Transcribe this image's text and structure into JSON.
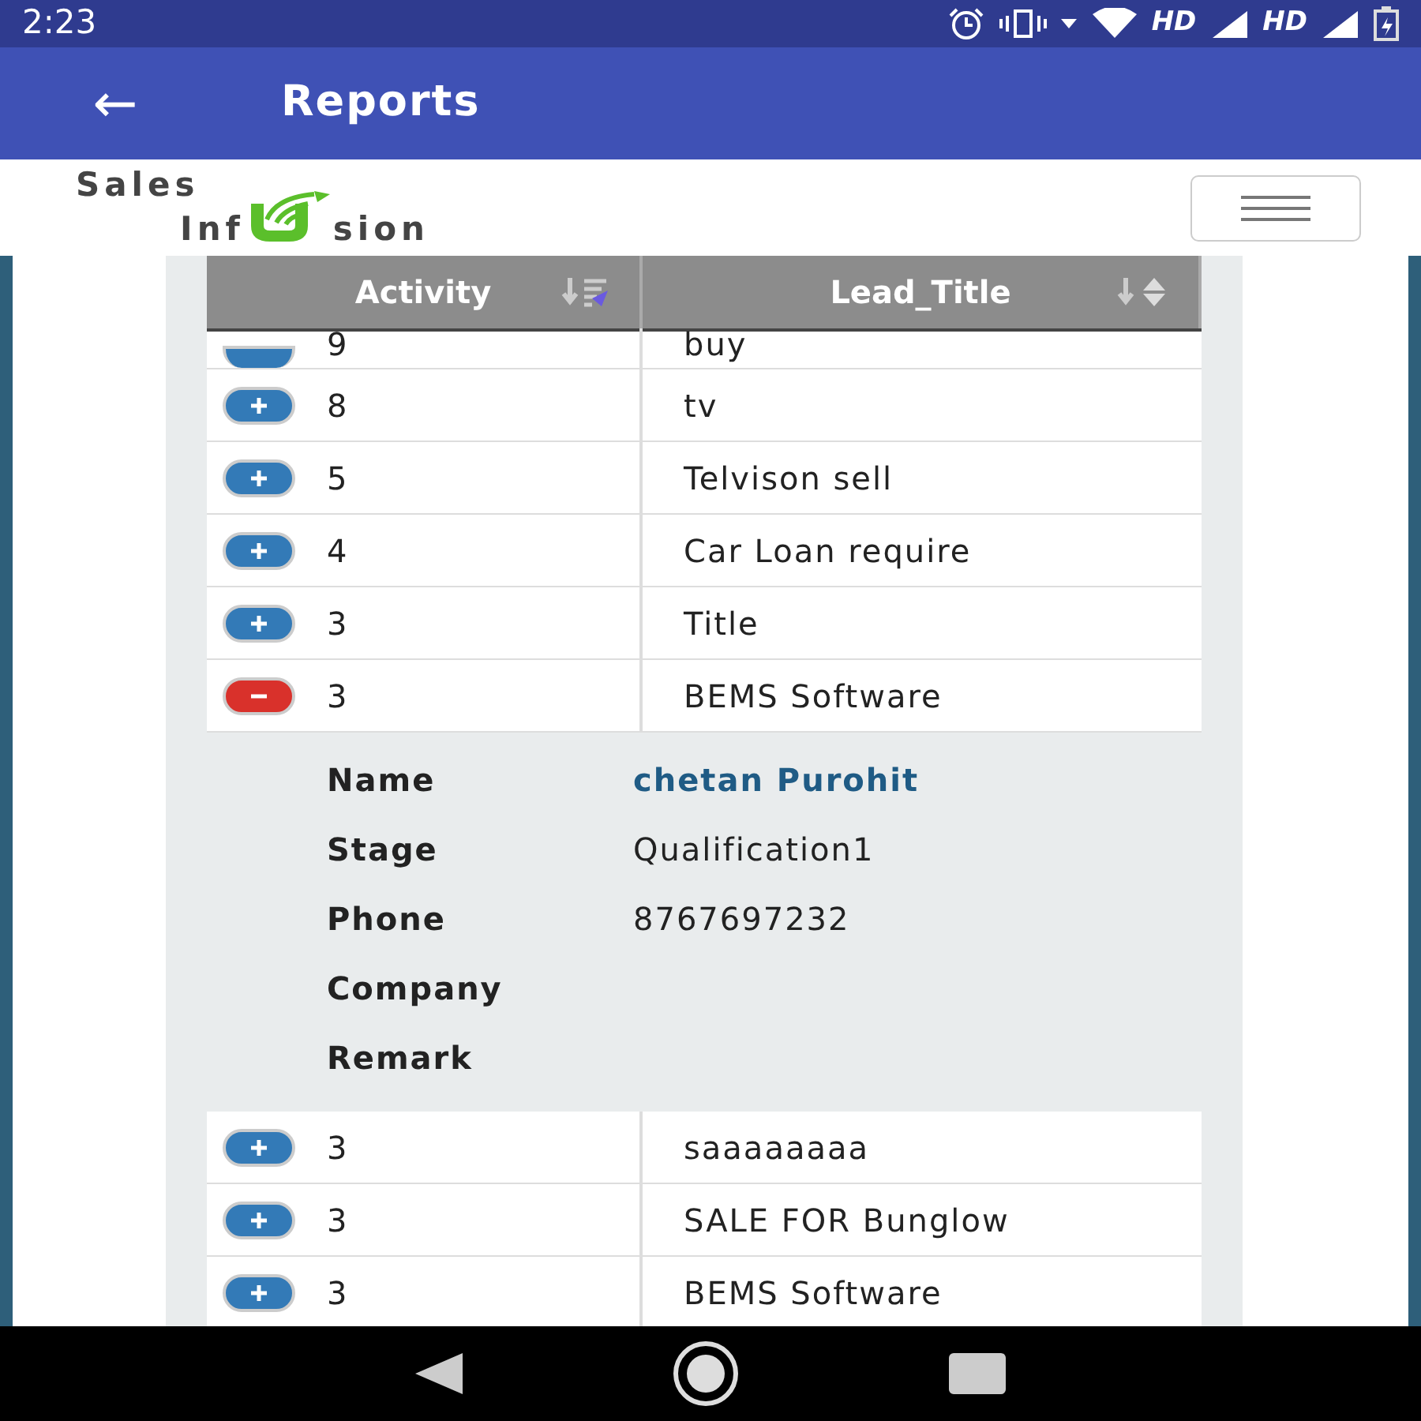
{
  "status_bar": {
    "time": "2:23",
    "network_labels": [
      "HD",
      "HD"
    ]
  },
  "app_bar": {
    "back_icon": "←",
    "title": "Reports"
  },
  "logo": {
    "line_1": "Sales",
    "line_2_start": "Inf",
    "line_2_end": "sion"
  },
  "table": {
    "columns": [
      {
        "label": "Activity",
        "sorted": true
      },
      {
        "label": "Lead_Title",
        "sorted": false
      }
    ],
    "rows": [
      {
        "activity": "9",
        "lead_title": "buy",
        "expanded": false,
        "partial": true
      },
      {
        "activity": "8",
        "lead_title": "tv",
        "expanded": false
      },
      {
        "activity": "5",
        "lead_title": "Telvison sell",
        "expanded": false
      },
      {
        "activity": "4",
        "lead_title": "Car Loan require",
        "expanded": false
      },
      {
        "activity": "3",
        "lead_title": "Title",
        "expanded": false
      },
      {
        "activity": "3",
        "lead_title": "BEMS Software",
        "expanded": true,
        "details": [
          {
            "label": "Name",
            "value": "chetan Purohit",
            "kind": "link"
          },
          {
            "label": "Stage",
            "value": "Qualification1",
            "kind": "text"
          },
          {
            "label": "Phone",
            "value": "8767697232",
            "kind": "text"
          },
          {
            "label": "Company"
          },
          {
            "label": "Remark"
          }
        ]
      },
      {
        "activity": "3",
        "lead_title": "saaaaaaaa",
        "expanded": false
      },
      {
        "activity": "3",
        "lead_title": "SALE FOR Bunglow",
        "expanded": false
      },
      {
        "activity": "3",
        "lead_title": "BEMS Software",
        "expanded": false
      }
    ]
  }
}
